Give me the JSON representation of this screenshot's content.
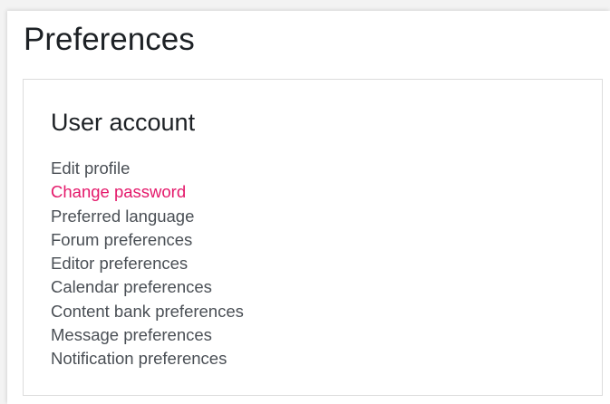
{
  "page": {
    "title": "Preferences"
  },
  "section": {
    "title": "User account",
    "links": [
      {
        "label": "Edit profile",
        "active": false
      },
      {
        "label": "Change password",
        "active": true
      },
      {
        "label": "Preferred language",
        "active": false
      },
      {
        "label": "Forum preferences",
        "active": false
      },
      {
        "label": "Editor preferences",
        "active": false
      },
      {
        "label": "Calendar preferences",
        "active": false
      },
      {
        "label": "Content bank preferences",
        "active": false
      },
      {
        "label": "Message preferences",
        "active": false
      },
      {
        "label": "Notification preferences",
        "active": false
      }
    ]
  },
  "colors": {
    "link": "#4a4f55",
    "link_active": "#e4186a",
    "heading": "#1d2125",
    "border": "#dcdcdc"
  }
}
